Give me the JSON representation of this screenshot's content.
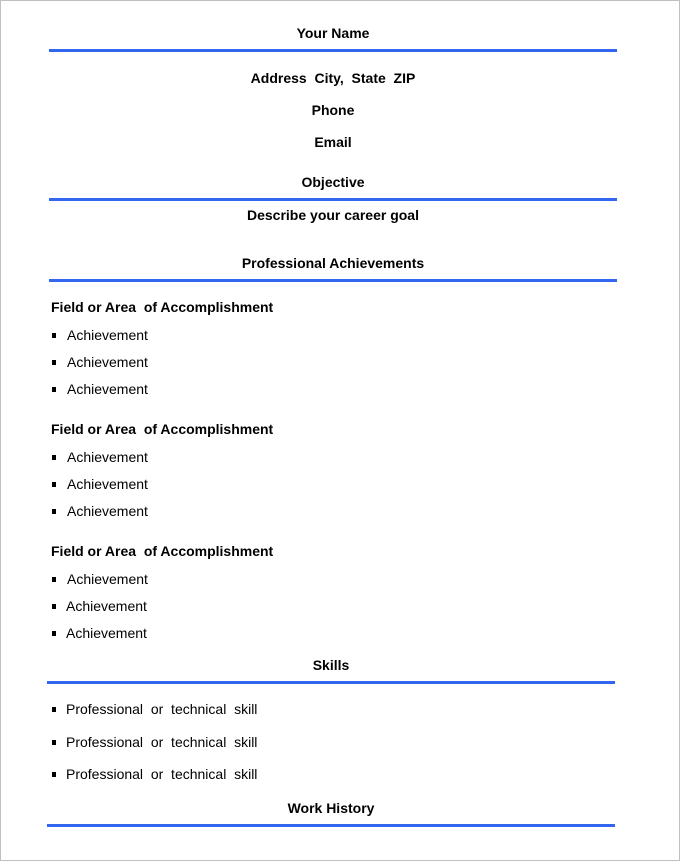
{
  "header": {
    "name": "Your Name",
    "address": "Address  City,  State  ZIP",
    "phone": "Phone",
    "email": "Email"
  },
  "objective": {
    "heading": "Objective",
    "text": "Describe your career goal"
  },
  "achievements": {
    "heading": "Professional Achievements",
    "groups": [
      {
        "field": "Field or Area  of Accomplishment",
        "items": [
          "Achievement",
          "Achievement",
          "Achievement"
        ]
      },
      {
        "field": "Field or Area  of Accomplishment",
        "items": [
          "Achievement",
          "Achievement",
          "Achievement"
        ]
      },
      {
        "field": "Field or Area  of Accomplishment",
        "items": [
          "Achievement",
          "Achievement",
          "Achievement"
        ]
      }
    ]
  },
  "skills": {
    "heading": "Skills",
    "items": [
      "Professional  or  technical  skill",
      "Professional  or  technical  skill",
      "Professional  or  technical  skill"
    ]
  },
  "work_history": {
    "heading": "Work History"
  },
  "colors": {
    "rule": "#3366ee",
    "text": "#000000",
    "page_border": "#c0c0c0"
  }
}
